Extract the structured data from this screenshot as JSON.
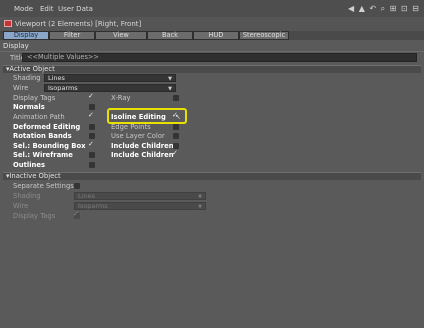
{
  "menubar": {
    "items": [
      "Mode",
      "Edit",
      "User Data"
    ],
    "icons": "◀ ▲ ↶ ⌕ ⊞ ⊡ ⊟"
  },
  "window": {
    "title": "Viewport (2 Elements) [Right, Front]"
  },
  "tabs": [
    {
      "label": "Display",
      "active": true
    },
    {
      "label": "Filter",
      "active": false
    },
    {
      "label": "View",
      "active": false
    },
    {
      "label": "Back",
      "active": false
    },
    {
      "label": "HUD",
      "active": false
    },
    {
      "label": "Stereoscopic",
      "active": false
    }
  ],
  "section": "Display",
  "title_field": {
    "label": "Title",
    "value": "<<Multiple Values>>"
  },
  "active_object": {
    "header": "▾Active Object",
    "shading": {
      "label": "Shading",
      "value": "Lines"
    },
    "wire": {
      "label": "Wire",
      "value": "Isoparms"
    },
    "display_tags": {
      "label": "Display Tags",
      "checked": true
    },
    "xray": {
      "label": "X-Ray",
      "checked": false
    },
    "normals": {
      "label": "Normals",
      "checked": false
    },
    "animation_path": {
      "label": "Animation Path",
      "checked": true
    },
    "isoline_editing": {
      "label": "Isoline Editing",
      "checked": true
    },
    "deformed_editing": {
      "label": "Deformed Editing",
      "checked": false
    },
    "edge_points": {
      "label": "Edge Points",
      "checked": false
    },
    "rotation_bands": {
      "label": "Rotation Bands",
      "checked": false
    },
    "use_layer_color": {
      "label": "Use Layer Color",
      "checked": false
    },
    "sel_bounding_box": {
      "label": "Sel.: Bounding Box",
      "checked": true
    },
    "include_children_1": {
      "label": "Include Children",
      "checked": false
    },
    "sel_wireframe": {
      "label": "Sel.: Wireframe",
      "checked": false
    },
    "include_children_2": {
      "label": "Include Children",
      "checked": true
    },
    "outlines": {
      "label": "Outlines",
      "checked": false
    }
  },
  "inactive_object": {
    "header": "▾Inactive Object",
    "separate_settings": {
      "label": "Separate Settings",
      "checked": false
    },
    "shading": {
      "label": "Shading",
      "value": "Lines"
    },
    "wire": {
      "label": "Wire",
      "value": "Isoparms"
    },
    "display_tags": {
      "label": "Display Tags",
      "checked": true
    }
  },
  "colors": {
    "accent_tab": "#8aa6c8",
    "highlight": "#e8e000",
    "title_icon": "#c83232"
  }
}
